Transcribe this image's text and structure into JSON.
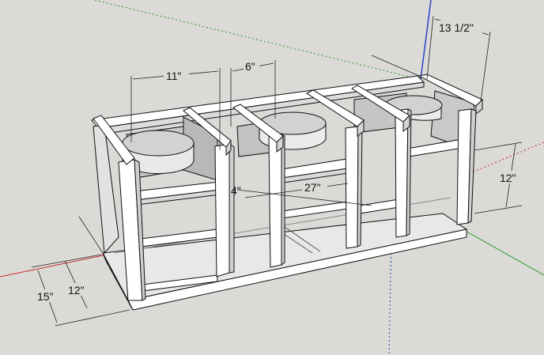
{
  "viewport": {
    "label": "SketchUp 3D model viewport"
  },
  "colors": {
    "background": "#dbdad7",
    "axis_red": "#c8282a",
    "axis_green": "#2a9a2a",
    "axis_blue": "#2a44c8",
    "wood_face": "#ffffff",
    "wood_side": "#e7e7e7",
    "wood_shade": "#bdbdbd",
    "edge": "#111111"
  },
  "dimensions": {
    "speaker_top_width": "13 1/2\"",
    "left_cutout_width": "11\"",
    "center_gap": "6\"",
    "inner_length": "27\"",
    "small_offset": "4\"",
    "right_height": "12\"",
    "left_inner_height": "12\"",
    "left_outer_height": "15\""
  }
}
